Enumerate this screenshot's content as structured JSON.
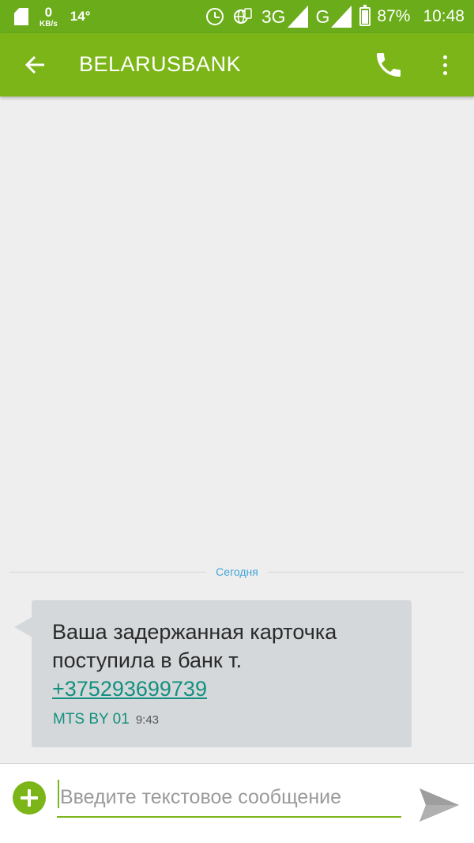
{
  "status_bar": {
    "speed_value": "0",
    "speed_unit": "KB/s",
    "temperature": "14°",
    "network_primary": "3G",
    "network_secondary": "G",
    "battery_percent": "87%",
    "battery_level": 0.87,
    "time": "10:48"
  },
  "app_bar": {
    "title": "BELARUSBANK"
  },
  "conversation": {
    "date_divider": "Сегодня",
    "messages": [
      {
        "text": "Ваша задержанная карточка поступила в банк т.",
        "link": "+375293699739",
        "sim_label": "MTS BY 01",
        "time": "9:43"
      }
    ]
  },
  "compose": {
    "placeholder": "Введите текстовое сообщение"
  },
  "colors": {
    "status_bar": "#6aac1a",
    "app_bar": "#7cb518",
    "bubble": "#d5d8da",
    "link": "#13907f",
    "date_divider": "#44a5d8"
  }
}
